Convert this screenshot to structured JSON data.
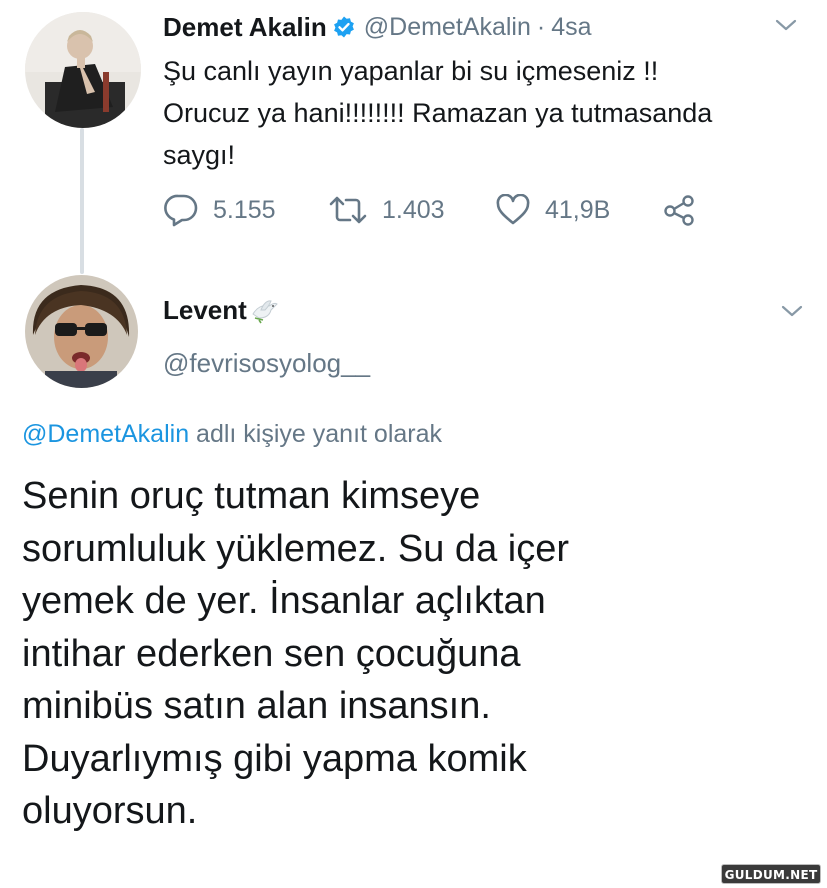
{
  "tweet1": {
    "name": "Demet Akalin",
    "handle": "@DemetAkalin",
    "separator": "·",
    "time": "4sa",
    "lines": [
      "Şu canlı yayın yapanlar bi su içmeseniz !!",
      "Orucuz ya hani!!!!!!!! Ramazan ya tutmasanda",
      "saygı!"
    ],
    "replies": "5.155",
    "retweets": "1.403",
    "likes": "41,9B",
    "verified_color": "#1da1f2"
  },
  "tweet2": {
    "name": "Levent",
    "handle": "@fevrisosyolog__",
    "reply_to_mention": "@DemetAkalin",
    "reply_to_text": " adlı kişiye yanıt olarak",
    "lines": [
      "Senin oruç tutman kimseye",
      "sorumluluk yüklemez. Su da içer",
      "yemek de yer.  İnsanlar açlıktan",
      "intihar ederken sen çocuğuna",
      "minibüs satın alan insansın.",
      "Duyarlıymış gibi yapma komik",
      "oluyorsun."
    ]
  },
  "watermark": "GULDUM.NET",
  "colors": {
    "text": "#14171a",
    "secondary": "#657786",
    "link": "#1b95e0"
  },
  "icons": [
    "chevron-down-icon",
    "verified-badge-icon",
    "reply-icon",
    "retweet-icon",
    "like-icon",
    "share-icon",
    "dove-emoji-icon"
  ]
}
